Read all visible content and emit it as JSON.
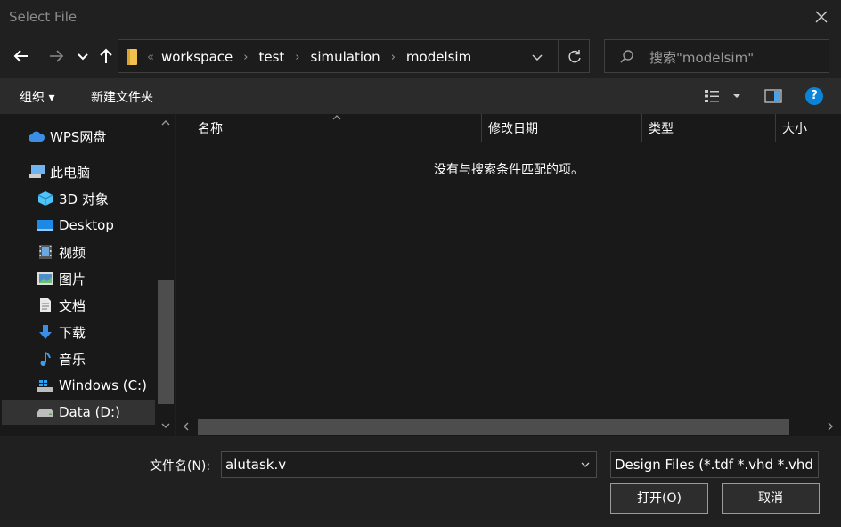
{
  "window": {
    "title": "Select File"
  },
  "nav": {
    "breadcrumb": [
      "workspace",
      "test",
      "simulation",
      "modelsim"
    ],
    "overflow_glyph": "«",
    "search_placeholder": "搜索\"modelsim\""
  },
  "toolbar": {
    "organize": "组织 ▾",
    "new_folder": "新建文件夹",
    "help_glyph": "?"
  },
  "sidebar": {
    "items": [
      {
        "label": "WPS网盘",
        "icon": "cloud-icon"
      },
      {
        "label": "此电脑",
        "icon": "computer-icon"
      },
      {
        "label": "3D 对象",
        "icon": "cube-icon"
      },
      {
        "label": "Desktop",
        "icon": "desktop-icon"
      },
      {
        "label": "视频",
        "icon": "video-icon"
      },
      {
        "label": "图片",
        "icon": "picture-icon"
      },
      {
        "label": "文档",
        "icon": "document-icon"
      },
      {
        "label": "下载",
        "icon": "download-icon"
      },
      {
        "label": "音乐",
        "icon": "music-icon"
      },
      {
        "label": "Windows (C:)",
        "icon": "windows-drive-icon"
      },
      {
        "label": "Data (D:)",
        "icon": "drive-icon",
        "selected": true
      }
    ]
  },
  "columns": [
    "名称",
    "修改日期",
    "类型",
    "大小"
  ],
  "empty_message": "没有与搜索条件匹配的项。",
  "footer": {
    "filename_label": "文件名(N):",
    "filename_value": "alutask.v",
    "filetype": "Design Files (*.tdf *.vhd *.vhd",
    "open_label": "打开(O)",
    "cancel_label": "取消"
  },
  "colors": {
    "accent": "#0a84d8",
    "background": "#202020",
    "panel": "#191919"
  }
}
